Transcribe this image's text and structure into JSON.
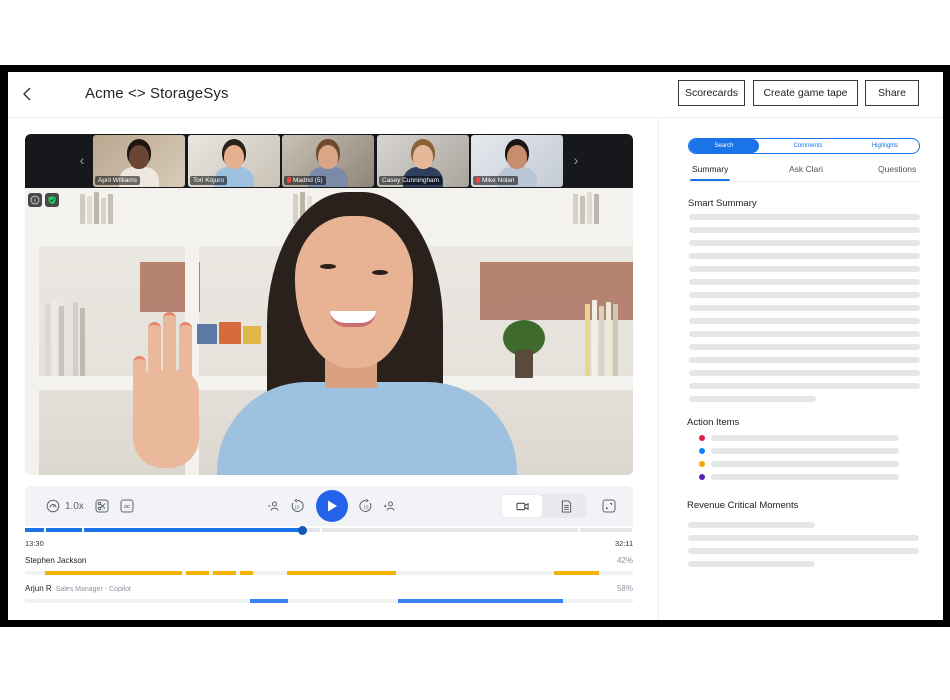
{
  "header": {
    "title": "Acme <> StorageSys",
    "buttons": {
      "scorecards": "Scorecards",
      "game_tape": "Create game tape",
      "share": "Share"
    }
  },
  "participants": [
    {
      "name": "April Williams",
      "muted": false,
      "active": false
    },
    {
      "name": "Tori Kojuro",
      "muted": false,
      "active": true
    },
    {
      "name": "Madrid (5)",
      "muted": true,
      "active": false
    },
    {
      "name": "Casey Cunningham",
      "muted": false,
      "active": false
    },
    {
      "name": "Mike Nolan",
      "muted": true,
      "active": false
    }
  ],
  "player": {
    "speed": "1.0x",
    "skip_back_seconds": "15",
    "skip_forward_seconds": "15",
    "progress": 0.456,
    "current_time": "13:30",
    "total_time": "32:11",
    "view_mode": "video",
    "colors": {
      "played": "#1a73e8",
      "play_button": "#2563eb"
    }
  },
  "speakers": [
    {
      "name": "Stephen Jackson",
      "role": "",
      "percent": "42%",
      "color": "#f5b301",
      "segments": [
        [
          0.033,
          0.258
        ],
        [
          0.265,
          0.303
        ],
        [
          0.309,
          0.347
        ],
        [
          0.354,
          0.375
        ],
        [
          0.431,
          0.61
        ],
        [
          0.87,
          0.944
        ]
      ]
    },
    {
      "name": "Arjun R",
      "role": "Sales Manager - Copilot",
      "percent": "58%",
      "color": "#3b82f6",
      "segments": [
        [
          0.37,
          0.433
        ],
        [
          0.614,
          0.885
        ]
      ]
    }
  ],
  "sidebar": {
    "segments": [
      "Search",
      "Comments",
      "Highlights"
    ],
    "active_segment": "Search",
    "tabs": [
      "Summary",
      "Ask Clari",
      "Questions"
    ],
    "active_tab": "Summary",
    "smart_summary_title": "Smart Summary",
    "action_items_title": "Action Items",
    "action_item_colors": [
      "#e11d48",
      "#0a84ff",
      "#f5a700",
      "#5b21b6"
    ],
    "revenue_title": "Revenue Critical Moments"
  }
}
